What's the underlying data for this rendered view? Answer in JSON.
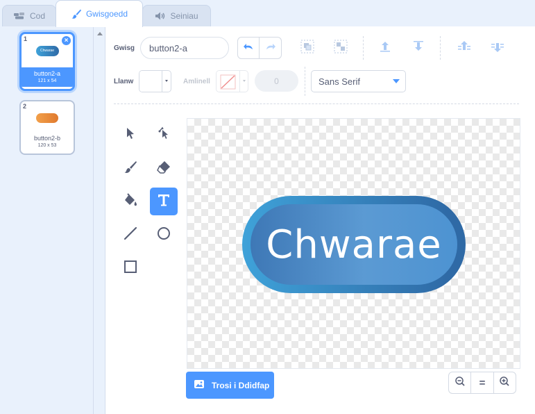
{
  "tabs": [
    {
      "label": "Cod",
      "icon": "code-icon"
    },
    {
      "label": "Gwisgoedd",
      "icon": "paintbrush-icon"
    },
    {
      "label": "Seiniau",
      "icon": "speaker-icon"
    }
  ],
  "costumes": [
    {
      "number": "1",
      "thumb_text": "Chwarae",
      "name": "button2-a",
      "size": "121 x 54"
    },
    {
      "number": "2",
      "name": "button2-b",
      "size": "120 x 53"
    }
  ],
  "toolbar": {
    "costume_label": "Gwisg",
    "costume_name": "button2-a",
    "fill_label": "Llanw",
    "outline_label": "Amlinell",
    "outline_width": "0",
    "font": "Sans Serif"
  },
  "canvas": {
    "button_text": "Chwarae"
  },
  "bottom": {
    "convert_label": "Trosi i Ddidfap",
    "zoom_reset": "="
  },
  "colors": {
    "accent": "#4c97ff",
    "button_outer": "#2f6aa6",
    "button_inner": "#4d93d2",
    "costume2_fill": "#ec8a3a"
  }
}
